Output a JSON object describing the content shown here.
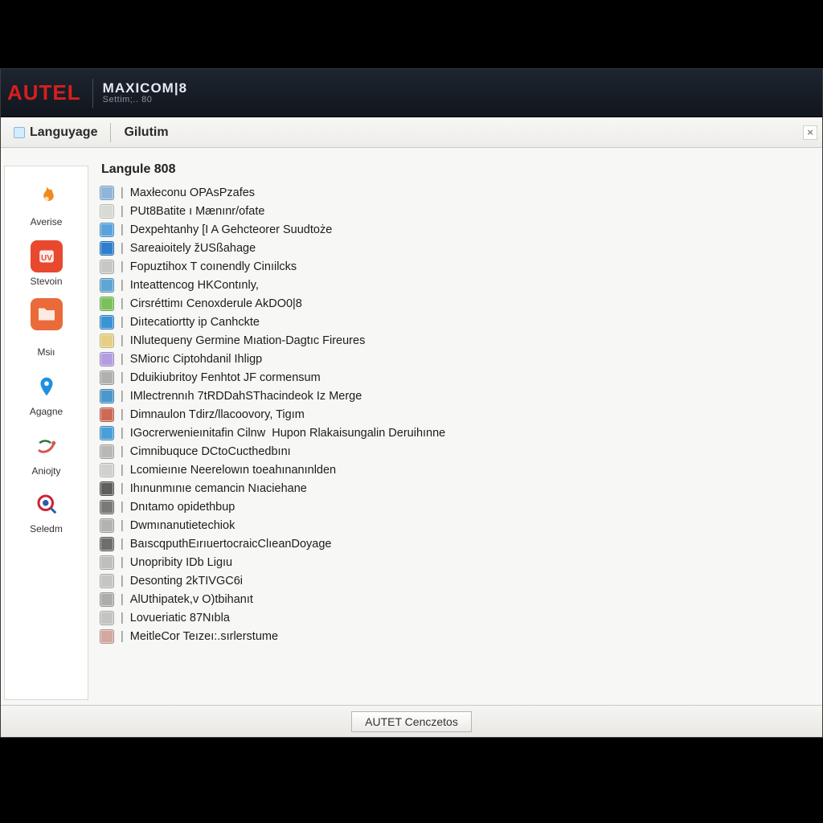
{
  "header": {
    "brand": "AUTEL",
    "product": "MAXICOM|8",
    "subtitle": "Settim;.. 80"
  },
  "tabs": {
    "language": "Languyage",
    "second": "Gilutim",
    "close": "×"
  },
  "section_title": "Langule 808",
  "sidebar": [
    {
      "label": "Averise"
    },
    {
      "label": "Stevoin"
    },
    {
      "label": "Msiı"
    },
    {
      "label": "Agagne"
    },
    {
      "label": "Aniojty"
    },
    {
      "label": "Seledm"
    }
  ],
  "rows": [
    {
      "ico": "#8fb6da",
      "text": "Maxłeconu OPAsPzafes"
    },
    {
      "ico": "#d9d9d5",
      "text": "PUt8Batite  ı Mænınr/ofate"
    },
    {
      "ico": "#5aa3dc",
      "text": "Dexpehtanhy [I  A Gehcteorer Suudtoże"
    },
    {
      "ico": "#2f7fce",
      "text": "Sareaioitely žUSßahage"
    },
    {
      "ico": "#c7c7c3",
      "text": "Fopuztihox T coınendly Cinıilcks"
    },
    {
      "ico": "#5fa6d4",
      "text": "Inteattencog HKContınly,"
    },
    {
      "ico": "#7bc15a",
      "text": "Cirsréttimı Cenoxderule AkDO0|8"
    },
    {
      "ico": "#3a94d6",
      "text": "Diıtecatiortty ip Canhckte "
    },
    {
      "ico": "#e4cf84",
      "text": "INlutequeny Germine Mıation-Dagtıc Fireures"
    },
    {
      "ico": "#b49de0",
      "text": "SMiorıc Ciptohdanil Ihligp"
    },
    {
      "ico": "#b0b0ac",
      "text": "Dduikiubritoy Fenhtot JF cormensum"
    },
    {
      "ico": "#4b97cc",
      "text": "IMlectrennıh 7tRDDahSThacindeok Iz Merge"
    },
    {
      "ico": "#cc6a55",
      "text": "Dimnaulon Tdirz/llacoovory, Tigım"
    },
    {
      "ico": "#4a9fd8",
      "text": "IGocrerwenieınitafin Cilnw"
    },
    {
      "ico": "#b8b8b4",
      "text": "Cimnibuquce DCtoCucthedbını"
    },
    {
      "ico": "#d0d0cc",
      "text": "Lcomieınıe Neerelowın toeahınanınlden"
    },
    {
      "ico": "#5f5f5b",
      "text": "Ihınunmınıe cemancin Nıaciehane"
    },
    {
      "ico": "#7a7a76",
      "text": "Dnıtamo opidethbup"
    },
    {
      "ico": "#b3b3af",
      "text": "Dwmınanutietechiok"
    },
    {
      "ico": "#6e6e6a",
      "text": "BaıscqputhEırıuertocraicClıeanDoyage"
    },
    {
      "ico": "#bfbfbb",
      "text": "Unopribity IDb Ligıu"
    },
    {
      "ico": "#c5c5c1",
      "text": "Desonting 2kTIVGC6i"
    },
    {
      "ico": "#adadab",
      "text": "AlUthipatek,v O)tbihanıt"
    },
    {
      "ico": "#c4c4c0",
      "text": "Lovueriatic 87Nıbla"
    },
    {
      "ico": "#d3a8a0",
      "text": "MeitleCor Teızeı:.sırlerstume"
    }
  ],
  "rows_extra": " Hupon Rlakaisungalin Deruihınne",
  "footer_btn": "AUTET Cenczetos"
}
